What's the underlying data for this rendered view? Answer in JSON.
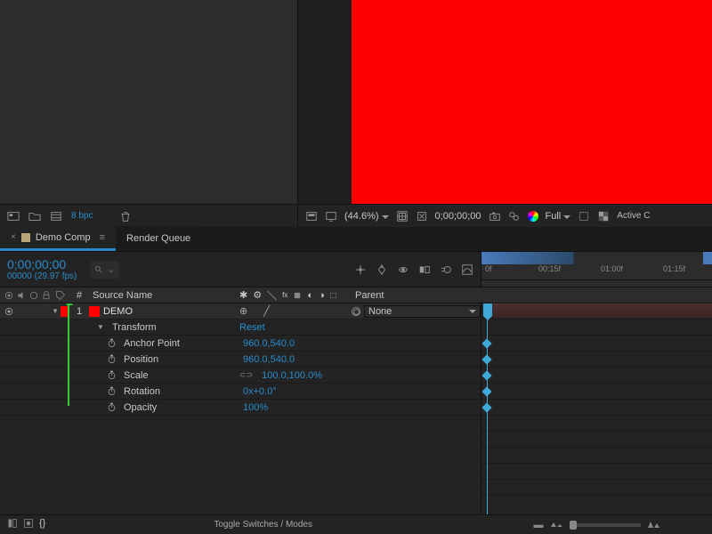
{
  "project_footer": {
    "bpc": "8 bpc"
  },
  "viewer_footer": {
    "zoom": "(44.6%)",
    "timecode": "0;00;00;00",
    "resolution": "Full",
    "view_mode": "Active C"
  },
  "tabs": {
    "comp_name": "Demo Comp",
    "render_queue": "Render Queue"
  },
  "timeline": {
    "timecode": "0;00;00;00",
    "frame_fps": "00000 (29.97 fps)",
    "col_num": "#",
    "col_source": "Source Name",
    "col_parent": "Parent",
    "ruler_ticks": [
      "0f",
      "00:15f",
      "01:00f",
      "01:15f"
    ],
    "layer": {
      "index": "1",
      "name": "DEMO",
      "color": "#ff0000",
      "parent_value": "None"
    },
    "transform_label": "Transform",
    "transform_reset": "Reset",
    "props": [
      {
        "name": "Anchor Point",
        "value": "960.0,540.0",
        "linked": false
      },
      {
        "name": "Position",
        "value": "960.0,540.0",
        "linked": false
      },
      {
        "name": "Scale",
        "value": "100.0,100.0%",
        "linked": true
      },
      {
        "name": "Rotation",
        "value": "0x+0.0°",
        "linked": false
      },
      {
        "name": "Opacity",
        "value": "100%",
        "linked": false
      }
    ],
    "footer_toggle": "Toggle Switches / Modes"
  }
}
